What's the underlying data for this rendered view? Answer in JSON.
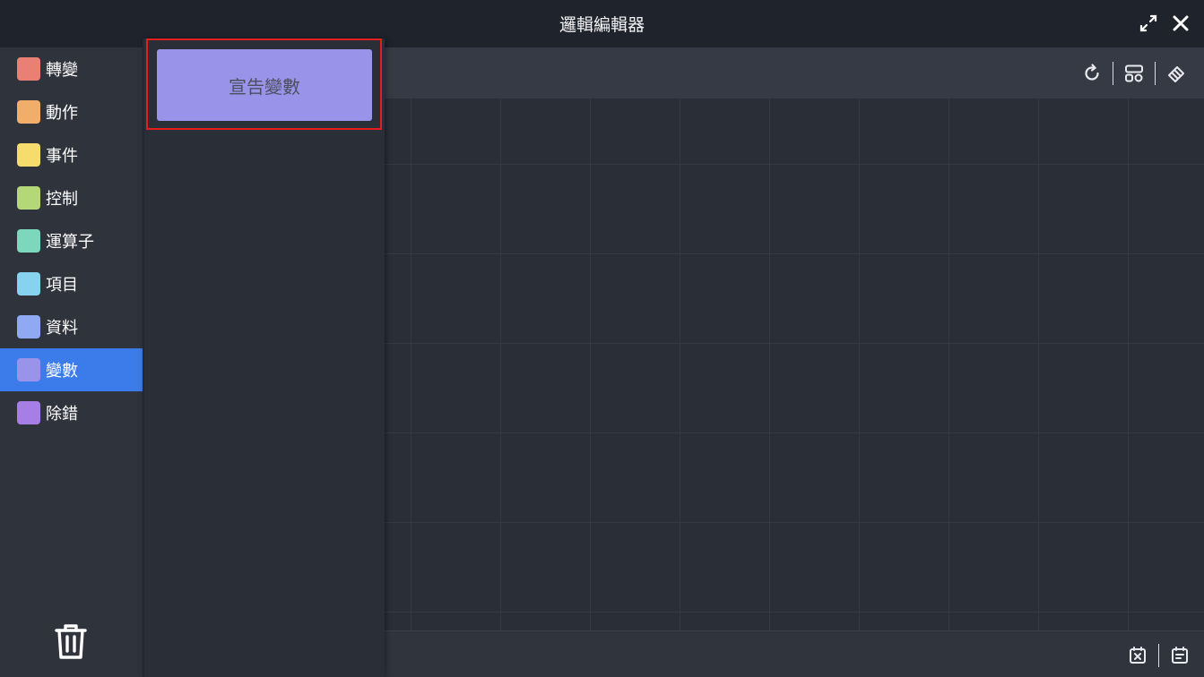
{
  "window": {
    "title": "邏輯編輯器",
    "actions": [
      {
        "icon": "expand-icon"
      },
      {
        "icon": "close-icon"
      }
    ]
  },
  "sidebar": {
    "categories": [
      {
        "label": "轉變",
        "color": "#ea7f74"
      },
      {
        "label": "動作",
        "color": "#f1ad6a"
      },
      {
        "label": "事件",
        "color": "#f6dc6d"
      },
      {
        "label": "控制",
        "color": "#b4d877"
      },
      {
        "label": "運算子",
        "color": "#7dd7bd"
      },
      {
        "label": "項目",
        "color": "#87d2ef"
      },
      {
        "label": "資料",
        "color": "#8fa9f3"
      },
      {
        "label": "變數",
        "color": "#9a93ea",
        "active": true
      },
      {
        "label": "除錯",
        "color": "#a77ee6"
      }
    ],
    "trash_icon": "trash-icon"
  },
  "flyout": {
    "blocks": [
      {
        "label": "宣告變數",
        "color": "#9a93ea"
      }
    ]
  },
  "toolbar": {
    "tools": [
      {
        "icon": "refresh-icon"
      },
      {
        "icon": "layout-icon"
      },
      {
        "icon": "eraser-icon"
      }
    ]
  },
  "footer": {
    "tools": [
      {
        "icon": "clear-icon"
      },
      {
        "icon": "notes-icon"
      }
    ]
  },
  "colors": {
    "active_category": "#3b7bea",
    "highlight_border": "#e21e1e"
  }
}
